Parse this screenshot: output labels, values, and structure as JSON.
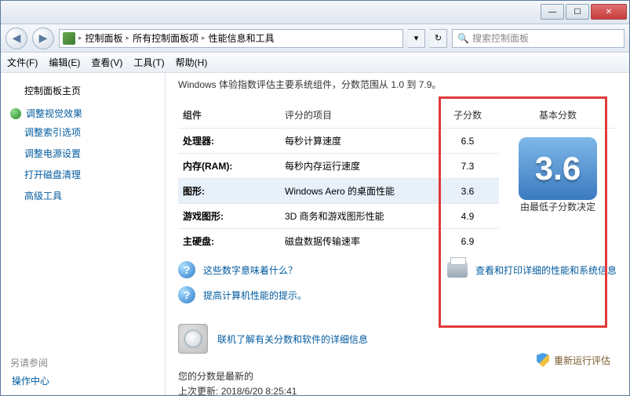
{
  "titlebar": {
    "min": "—",
    "max": "☐",
    "close": "✕"
  },
  "nav": {
    "back": "◀",
    "fwd": "▶",
    "crumb1": "控制面板",
    "crumb2": "所有控制面板项",
    "crumb3": "性能信息和工具",
    "dropdown": "▾",
    "refresh": "↻"
  },
  "search": {
    "placeholder": "搜索控制面板"
  },
  "menu": {
    "file": "文件(F)",
    "edit": "编辑(E)",
    "view": "查看(V)",
    "tools": "工具(T)",
    "help": "帮助(H)"
  },
  "sidebar": {
    "main": "控制面板主页",
    "adjust_visual": "调整视觉效果",
    "adjust_index": "调整索引选项",
    "adjust_power": "调整电源设置",
    "disk_cleanup": "打开磁盘清理",
    "advanced": "高级工具",
    "see_also_hdr": "另请参阅",
    "action_center": "操作中心"
  },
  "content": {
    "intro": "Windows 体验指数评估主要系统组件，分数范围从 1.0 到 7.9。",
    "hdr_component": "组件",
    "hdr_rated": "评分的项目",
    "hdr_sub": "子分数",
    "hdr_base": "基本分数",
    "rows": [
      {
        "comp": "处理器:",
        "rated": "每秒计算速度",
        "sub": "6.5"
      },
      {
        "comp": "内存(RAM):",
        "rated": "每秒内存运行速度",
        "sub": "7.3"
      },
      {
        "comp": "图形:",
        "rated": "Windows Aero 的桌面性能",
        "sub": "3.6"
      },
      {
        "comp": "游戏图形:",
        "rated": "3D 商务和游戏图形性能",
        "sub": "4.9"
      },
      {
        "comp": "主硬盘:",
        "rated": "磁盘数据传输速率",
        "sub": "6.9"
      }
    ],
    "base_score": "3.6",
    "base_caption": "由最低子分数决定",
    "link_meaning": "这些数字意味着什么？",
    "link_print": "查看和打印详细的性能和系统信息",
    "link_tips": "提高计算机性能的提示。",
    "link_online": "联机了解有关分数和软件的详细信息",
    "score_latest": "您的分数是最新的",
    "last_update_label": "上次更新:",
    "last_update_value": "2018/6/20 8:25:41",
    "rerun": "重新运行评估"
  }
}
